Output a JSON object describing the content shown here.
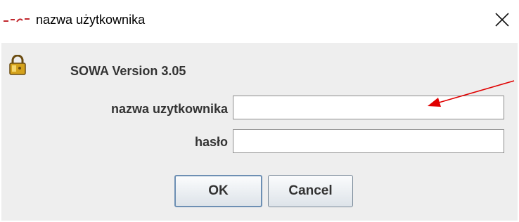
{
  "window": {
    "title": "nazwa użytkownika",
    "app_icon": "java-cup-icon",
    "close_icon": "close-icon",
    "close_symbol": "✕"
  },
  "dialog": {
    "lock_icon": "lock-icon",
    "version_label": "SOWA Version 3.05",
    "username_label": "nazwa uzytkownika",
    "username_value": "",
    "password_label": "hasło",
    "password_value": "",
    "ok_label": "OK",
    "cancel_label": "Cancel"
  },
  "annotation": {
    "arrow_color": "#e00000"
  },
  "colors": {
    "dialog_background": "#eeeeee",
    "label_text": "#333333",
    "field_border": "#8c8c8c"
  }
}
